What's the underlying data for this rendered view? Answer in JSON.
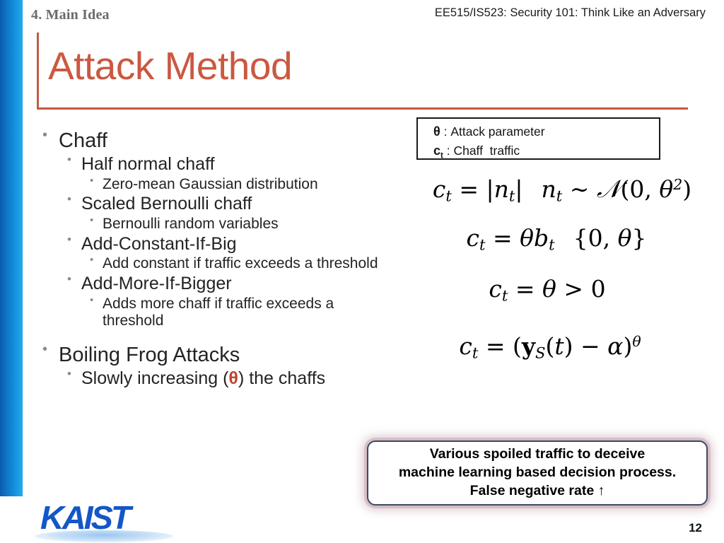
{
  "header": {
    "section_label": "4. Main Idea",
    "course_label": "EE515/IS523: Security 101: Think Like an Adversary"
  },
  "title": "Attack Method",
  "colors": {
    "title_accent": "#cb5840",
    "rule": "#c15a43",
    "stripe_dark": "#0a5ca8",
    "stripe_light": "#1fa9ef",
    "theta_accent": "#c1452b",
    "logo_blue": "#1357c8",
    "callout_border": "#3c4a63"
  },
  "bullets": [
    {
      "level": 1,
      "text": "Chaff"
    },
    {
      "level": 2,
      "text": "Half normal chaff"
    },
    {
      "level": 3,
      "text": "Zero-mean Gaussian distribution"
    },
    {
      "level": 2,
      "text": "Scaled Bernoulli chaff"
    },
    {
      "level": 3,
      "text": "Bernoulli random variables"
    },
    {
      "level": 2,
      "text": "Add-Constant-If-Big"
    },
    {
      "level": 3,
      "text": "Add constant if traffic exceeds a threshold"
    },
    {
      "level": 2,
      "text": "Add-More-If-Bigger"
    },
    {
      "level": 3,
      "text": "Adds more chaff if traffic exceeds a threshold"
    },
    {
      "level": 1,
      "text": "Boiling Frog Attacks"
    },
    {
      "level": 2,
      "text": "Slowly increasing (θ) the chaffs",
      "parts": {
        "pre": "Slowly increasing (",
        "accent": "θ",
        "post": ") the chaffs"
      }
    }
  ],
  "legend": {
    "rows": [
      {
        "symbol": "θ",
        "sub": "",
        "definition": " : Attack parameter"
      },
      {
        "symbol": "c",
        "sub": "t",
        "definition": " : Chaff  traffic"
      }
    ]
  },
  "equations": [
    {
      "id": "eq1",
      "latex": "c_t = |n_t|   n_t ~ N(0, θ²)"
    },
    {
      "id": "eq2",
      "latex": "c_t = θb_t   {0, θ}"
    },
    {
      "id": "eq3",
      "latex": "c_t = θ > 0"
    },
    {
      "id": "eq4",
      "latex": "c_t = (y_S(t) − α)^θ"
    }
  ],
  "callout": {
    "line1": "Various spoiled traffic to deceive",
    "line2": "machine learning based decision process.",
    "line3": "False negative rate ↑"
  },
  "footer": {
    "logo_text": "KAIST",
    "page_number": "12"
  }
}
